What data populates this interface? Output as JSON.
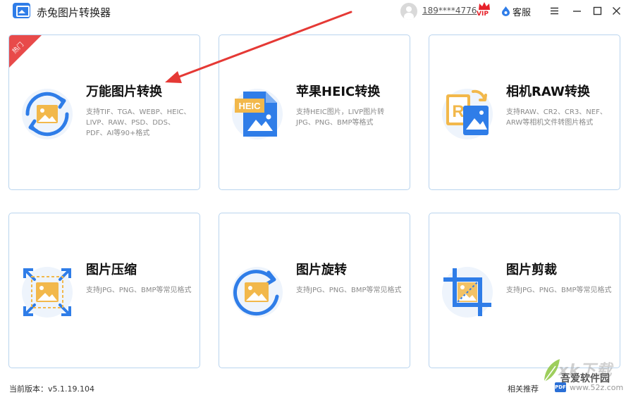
{
  "window": {
    "title": "赤兔图片转换器",
    "user_phone": "189****4776",
    "vip_label": "VIP",
    "service_label": "客服"
  },
  "cards": [
    {
      "title": "万能图片转换",
      "desc": "支持TIF、TGA、WEBP、HEIC、LIVP、RAW、PSD、DDS、PDF、AI等90+格式",
      "badge": "热门",
      "icon": "universal-convert-icon"
    },
    {
      "title": "苹果HEIC转换",
      "desc": "支持HEIC图片，LIVP图片转JPG、PNG、BMP等格式",
      "icon": "heic-file-icon",
      "icon_text": "HEIC"
    },
    {
      "title": "相机RAW转换",
      "desc": "支持RAW、CR2、CR3、NEF、ARW等相机文件转图片格式",
      "icon": "raw-file-icon",
      "icon_text": "R"
    },
    {
      "title": "图片压缩",
      "desc": "支持JPG、PNG、BMP等常见格式",
      "icon": "compress-icon"
    },
    {
      "title": "图片旋转",
      "desc": "支持JPG、PNG、BMP等常见格式",
      "icon": "rotate-icon"
    },
    {
      "title": "图片剪裁",
      "desc": "支持JPG、PNG、BMP等常见格式",
      "icon": "crop-icon"
    }
  ],
  "footer": {
    "version": "当前版本：v5.1.19.104",
    "recommend": "相关推荐",
    "badge": "PDF",
    "site": "www.52z.com"
  },
  "watermark": {
    "brand": "xk下载",
    "name": "吾爱软件园"
  },
  "colors": {
    "accent_blue": "#2f7de8",
    "image_yellow": "#f2b84b",
    "hot_red": "#e84a4a",
    "card_border": "#b9d4ee",
    "annotation_red": "#e53935"
  }
}
